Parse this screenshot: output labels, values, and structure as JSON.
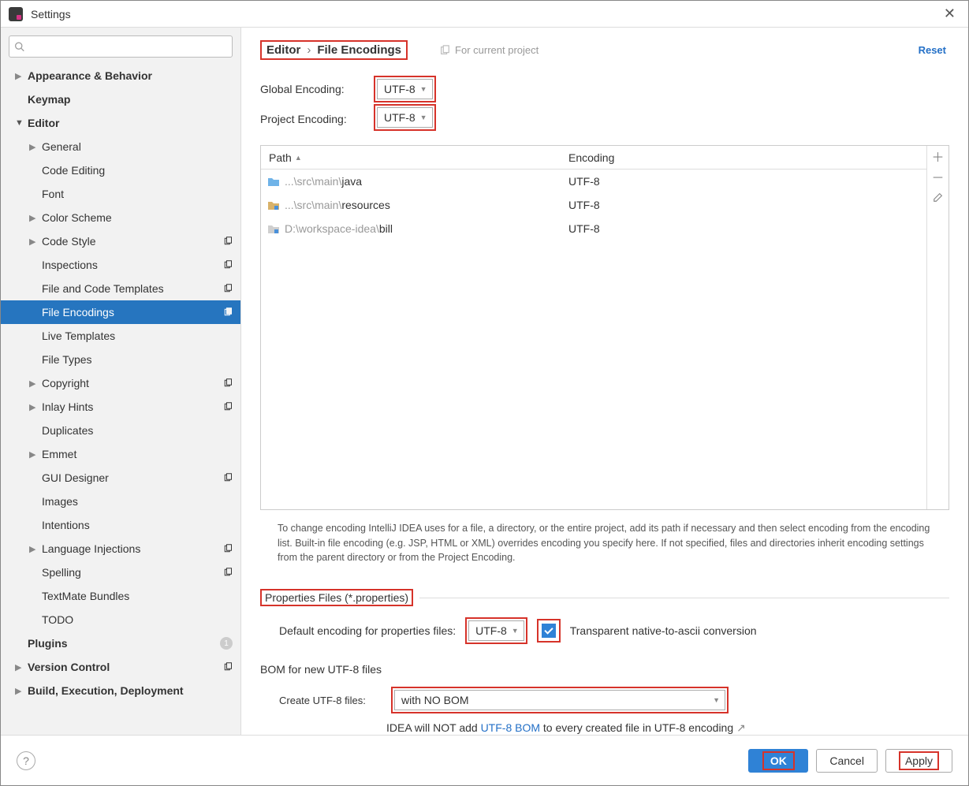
{
  "window": {
    "title": "Settings"
  },
  "header": {
    "breadcrumb1": "Editor",
    "breadcrumb2": "File Encodings",
    "project_label": "For current project",
    "reset": "Reset"
  },
  "sidebar": {
    "items": [
      {
        "label": "Appearance & Behavior",
        "arrow": "right",
        "bold": true,
        "level": 0
      },
      {
        "label": "Keymap",
        "arrow": "",
        "bold": true,
        "level": 0
      },
      {
        "label": "Editor",
        "arrow": "down",
        "bold": true,
        "level": 0
      },
      {
        "label": "General",
        "arrow": "right",
        "bold": false,
        "level": 1
      },
      {
        "label": "Code Editing",
        "arrow": "",
        "bold": false,
        "level": 1
      },
      {
        "label": "Font",
        "arrow": "",
        "bold": false,
        "level": 1
      },
      {
        "label": "Color Scheme",
        "arrow": "right",
        "bold": false,
        "level": 1
      },
      {
        "label": "Code Style",
        "arrow": "right",
        "bold": false,
        "level": 1,
        "copy": true
      },
      {
        "label": "Inspections",
        "arrow": "",
        "bold": false,
        "level": 1,
        "copy": true
      },
      {
        "label": "File and Code Templates",
        "arrow": "",
        "bold": false,
        "level": 1,
        "copy": true
      },
      {
        "label": "File Encodings",
        "arrow": "",
        "bold": false,
        "level": 1,
        "copy": true,
        "selected": true
      },
      {
        "label": "Live Templates",
        "arrow": "",
        "bold": false,
        "level": 1
      },
      {
        "label": "File Types",
        "arrow": "",
        "bold": false,
        "level": 1
      },
      {
        "label": "Copyright",
        "arrow": "right",
        "bold": false,
        "level": 1,
        "copy": true
      },
      {
        "label": "Inlay Hints",
        "arrow": "right",
        "bold": false,
        "level": 1,
        "copy": true
      },
      {
        "label": "Duplicates",
        "arrow": "",
        "bold": false,
        "level": 1
      },
      {
        "label": "Emmet",
        "arrow": "right",
        "bold": false,
        "level": 1
      },
      {
        "label": "GUI Designer",
        "arrow": "",
        "bold": false,
        "level": 1,
        "copy": true
      },
      {
        "label": "Images",
        "arrow": "",
        "bold": false,
        "level": 1
      },
      {
        "label": "Intentions",
        "arrow": "",
        "bold": false,
        "level": 1
      },
      {
        "label": "Language Injections",
        "arrow": "right",
        "bold": false,
        "level": 1,
        "copy": true
      },
      {
        "label": "Spelling",
        "arrow": "",
        "bold": false,
        "level": 1,
        "copy": true
      },
      {
        "label": "TextMate Bundles",
        "arrow": "",
        "bold": false,
        "level": 1
      },
      {
        "label": "TODO",
        "arrow": "",
        "bold": false,
        "level": 1
      },
      {
        "label": "Plugins",
        "arrow": "",
        "bold": true,
        "level": 0,
        "badge": "1"
      },
      {
        "label": "Version Control",
        "arrow": "right",
        "bold": true,
        "level": 0,
        "copy": true
      },
      {
        "label": "Build, Execution, Deployment",
        "arrow": "right",
        "bold": true,
        "level": 0
      }
    ]
  },
  "encodings": {
    "global_label": "Global Encoding:",
    "global_value": "UTF-8",
    "project_label": "Project Encoding:",
    "project_value": "UTF-8"
  },
  "table": {
    "header_path": "Path",
    "header_encoding": "Encoding",
    "rows": [
      {
        "prefix": "...\\src\\main\\",
        "suffix": "java",
        "encoding": "UTF-8",
        "icon": "folder-blue"
      },
      {
        "prefix": "...\\src\\main\\",
        "suffix": "resources",
        "encoding": "UTF-8",
        "icon": "folder-res"
      },
      {
        "prefix": "D:\\workspace-idea\\",
        "suffix": "bill",
        "encoding": "UTF-8",
        "icon": "folder-module"
      }
    ]
  },
  "help_text": "To change encoding IntelliJ IDEA uses for a file, a directory, or the entire project, add its path if necessary and then select encoding from the encoding list. Built-in file encoding (e.g. JSP, HTML or XML) overrides encoding you specify here. If not specified, files and directories inherit encoding settings from the parent directory or from the Project Encoding.",
  "properties": {
    "section_title": "Properties Files (*.properties)",
    "default_label": "Default encoding for properties files:",
    "default_value": "UTF-8",
    "checkbox_label": "Transparent native-to-ascii conversion"
  },
  "bom": {
    "section_title": "BOM for new UTF-8 files",
    "create_label": "Create UTF-8 files:",
    "create_value": "with NO BOM",
    "note_prefix": "IDEA will NOT add ",
    "note_link": "UTF-8 BOM",
    "note_suffix": " to every created file in UTF-8 encoding"
  },
  "footer": {
    "ok": "OK",
    "cancel": "Cancel",
    "apply": "Apply"
  }
}
